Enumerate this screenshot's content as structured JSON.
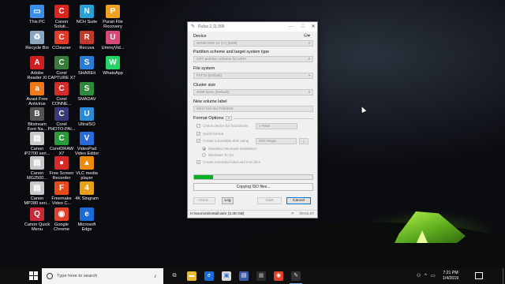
{
  "desktop_icons": [
    {
      "label": "This PC",
      "icon": "this-pc-icon",
      "color": "#3a8ee6",
      "glyph": "▭"
    },
    {
      "label": "Canon\nSoluti...",
      "icon": "canon-solution-icon",
      "color": "#d7261e",
      "glyph": "C"
    },
    {
      "label": "NCH Suite",
      "icon": "nch-suite-icon",
      "color": "#2aa0d8",
      "glyph": "N"
    },
    {
      "label": "Puran File\nRecovery",
      "icon": "puran-file-recovery-icon",
      "color": "#f0a020",
      "glyph": "P"
    },
    {
      "label": "Recycle Bin",
      "icon": "recycle-bin-icon",
      "color": "#8aa6c0",
      "glyph": "♻"
    },
    {
      "label": "CCleaner",
      "icon": "ccleaner-icon",
      "color": "#e23a2a",
      "glyph": "C"
    },
    {
      "label": "Recuva",
      "icon": "recuva-icon",
      "color": "#c0392b",
      "glyph": "R"
    },
    {
      "label": "UmmyVid...",
      "icon": "ummyvideo-icon",
      "color": "#d64a7a",
      "glyph": "U"
    },
    {
      "label": "Adobe\nReader XI",
      "icon": "adobe-reader-icon",
      "color": "#cc1f1f",
      "glyph": "A"
    },
    {
      "label": "Corel\nCAPTURE X7",
      "icon": "corel-capture-icon",
      "color": "#3a7a3a",
      "glyph": "C"
    },
    {
      "label": "SHAREit",
      "icon": "shareit-icon",
      "color": "#2a7ad8",
      "glyph": "S"
    },
    {
      "label": "WhatsApp",
      "icon": "whatsapp-icon",
      "color": "#25d366",
      "glyph": "W"
    },
    {
      "label": "Avast Free\nAntivirus",
      "icon": "avast-icon",
      "color": "#f07a1a",
      "glyph": "a"
    },
    {
      "label": "Corel\nCONNE...",
      "icon": "corel-connect-icon",
      "color": "#d32a2a",
      "glyph": "C"
    },
    {
      "label": "SMADAV",
      "icon": "smadav-icon",
      "color": "#2e8b3a",
      "glyph": "S"
    },
    {
      "label": "Bitstream\nFont Na...",
      "icon": "bitstream-font-icon",
      "color": "#555555",
      "glyph": "B"
    },
    {
      "label": "Corel\nPHOTO-PAI...",
      "icon": "corel-photopaint-icon",
      "color": "#3a3a7a",
      "glyph": "C"
    },
    {
      "label": "UltraISO",
      "icon": "ultraiso-icon",
      "color": "#2a8ad8",
      "glyph": "U"
    },
    {
      "label": "Canon\niP2700 seri...",
      "icon": "canon-ip2700-icon",
      "color": "#c8c8c8",
      "glyph": "▤"
    },
    {
      "label": "CorelDRAW\nX7",
      "icon": "coreldraw-icon",
      "color": "#2a9a3a",
      "glyph": "C"
    },
    {
      "label": "VideoPad\nVideo Editor",
      "icon": "videopad-icon",
      "color": "#2a6ad8",
      "glyph": "V"
    },
    {
      "label": "Canon\nMG2500...",
      "icon": "canon-mg2500-icon",
      "color": "#c8c8c8",
      "glyph": "▤"
    },
    {
      "label": "Free Screen\nRecorder",
      "icon": "free-screen-recorder-icon",
      "color": "#d62a2a",
      "glyph": "●"
    },
    {
      "label": "VLC media\nplayer",
      "icon": "vlc-icon",
      "color": "#f08a0a",
      "glyph": "▲"
    },
    {
      "label": "Canon\nMP280 seri...",
      "icon": "canon-mp280-icon",
      "color": "#c8c8c8",
      "glyph": "▤"
    },
    {
      "label": "Freemake\nVideo C...",
      "icon": "freemake-icon",
      "color": "#e84a1a",
      "glyph": "F"
    },
    {
      "label": "4K Stogram",
      "icon": "4k-stogram-icon",
      "color": "#e8a01a",
      "glyph": "4"
    },
    {
      "label": "Canon Quick\nMenu",
      "icon": "canon-quick-menu-icon",
      "color": "#c8283a",
      "glyph": "Q"
    },
    {
      "label": "Google\nChrome",
      "icon": "google-chrome-icon",
      "color": "#e0412a",
      "glyph": "◉"
    },
    {
      "label": "Microsoft\nEdge",
      "icon": "microsoft-edge-icon",
      "color": "#1a6ad8",
      "glyph": "e"
    }
  ],
  "rufus": {
    "title": "Rufus 2.11.995",
    "device_label": "Device",
    "device_value": "WINDOWS 10 (H:) [8GB]",
    "partition_label": "Partition scheme and target system type",
    "partition_value": "GPT partition scheme for UEFI",
    "filesystem_label": "File system",
    "filesystem_value": "FAT32 (Default)",
    "cluster_label": "Cluster size",
    "cluster_value": "4096 bytes (Default)",
    "volume_label_title": "New volume label",
    "volume_label_value": "Win7-U8-x64-Feb2018",
    "format_options_label": "Format Options",
    "check_bad_blocks_label": "Check device for bad blocks",
    "passes_value": "1 Pass",
    "quick_format_label": "Quick format",
    "bootable_label": "Create a bootable disk using",
    "image_type_value": "ISO Image",
    "standard_install_label": "Standard Windows installation",
    "windows_to_go_label": "Windows To Go",
    "extended_label": "Create extended label and icon files",
    "progress_fraction": 0.16,
    "status_text": "Copying ISO files...",
    "about_label": "About...",
    "log_label": "Log",
    "start_label": "Start",
    "cancel_label": "Cancel",
    "statusbar_text": "H:\\sources\\install.wim (3.38 GB)",
    "elapsed": "00:01:47"
  },
  "taskbar": {
    "search_placeholder": "Type here to search",
    "clock_time": "7:21 PM",
    "clock_date": "1/4/2019",
    "accent": "#0078d7"
  }
}
